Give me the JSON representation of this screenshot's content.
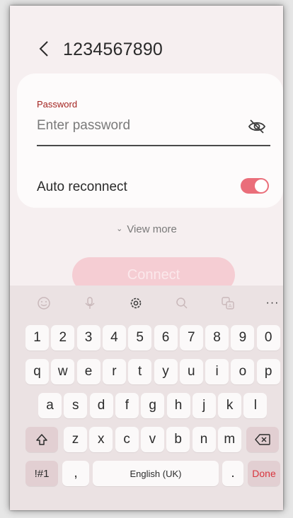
{
  "header": {
    "network_name": "1234567890"
  },
  "password_form": {
    "label": "Password",
    "placeholder": "Enter password",
    "value": ""
  },
  "auto_reconnect": {
    "label": "Auto reconnect",
    "enabled": true
  },
  "view_more_label": "View more",
  "connect_label": "Connect",
  "keyboard": {
    "toolbar": [
      "emoji-icon",
      "microphone-icon",
      "settings-icon",
      "search-icon",
      "translate-icon",
      "more-icon"
    ],
    "more_label": "···",
    "number_row": [
      "1",
      "2",
      "3",
      "4",
      "5",
      "6",
      "7",
      "8",
      "9",
      "0"
    ],
    "row1": [
      "q",
      "w",
      "e",
      "r",
      "t",
      "y",
      "u",
      "i",
      "o",
      "p"
    ],
    "row2": [
      "a",
      "s",
      "d",
      "f",
      "g",
      "h",
      "j",
      "k",
      "l"
    ],
    "row3": [
      "z",
      "x",
      "c",
      "v",
      "b",
      "n",
      "m"
    ],
    "symbols_label": "!#1",
    "comma_label": ",",
    "space_label": "English (UK)",
    "period_label": ".",
    "done_label": "Done"
  },
  "colors": {
    "accent": "#ea6e7a",
    "label_red": "#a3231f",
    "connect_disabled": "#f5cdd3",
    "done_text": "#d8353e"
  }
}
